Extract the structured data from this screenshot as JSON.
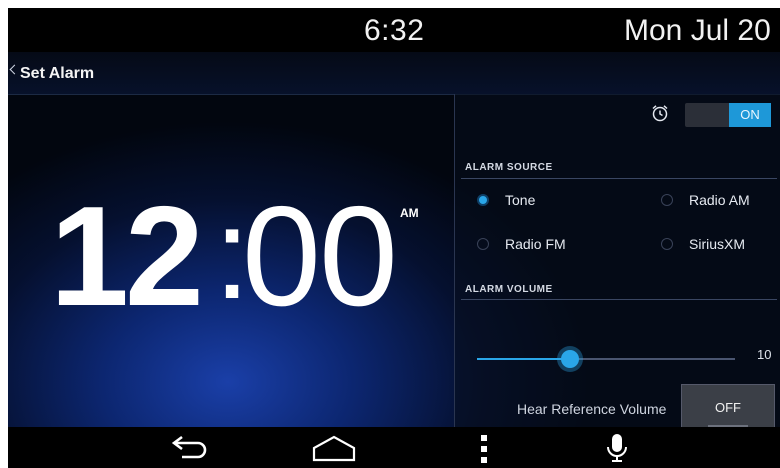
{
  "status": {
    "time": "6:32",
    "date": "Mon Jul 20"
  },
  "header": {
    "title": "Set Alarm"
  },
  "clock": {
    "hours": "12",
    "separator": ":",
    "minutes": "00",
    "ampm": "AM"
  },
  "alarm_toggle": {
    "state_label": "ON",
    "icon": "alarm-clock-icon",
    "accent_color": "#1e98d8"
  },
  "alarm_source": {
    "label": "ALARM SOURCE",
    "options": [
      {
        "label": "Tone",
        "selected": true
      },
      {
        "label": "Radio AM",
        "selected": false
      },
      {
        "label": "Radio FM",
        "selected": false
      },
      {
        "label": "SiriusXM",
        "selected": false
      }
    ]
  },
  "alarm_volume": {
    "label": "ALARM VOLUME",
    "value": "10",
    "level_fraction": 0.36
  },
  "reference_volume": {
    "label": "Hear Reference Volume",
    "button_label": "OFF"
  },
  "nav": {
    "icons": [
      "back-icon",
      "home-icon",
      "menu-icon",
      "microphone-icon"
    ]
  }
}
